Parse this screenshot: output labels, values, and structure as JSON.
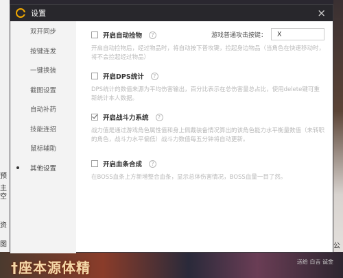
{
  "dialog": {
    "title": "设置",
    "close_glyph": "×"
  },
  "sidebar": {
    "items": [
      {
        "label": "双开同步"
      },
      {
        "label": "按键连发"
      },
      {
        "label": "一键换装"
      },
      {
        "label": "截图设置"
      },
      {
        "label": "自动补药"
      },
      {
        "label": "技能连招"
      },
      {
        "label": "鼠标辅助"
      },
      {
        "label": "其他设置",
        "active": true
      }
    ]
  },
  "options": [
    {
      "label": "开启自动捡物",
      "checked": false,
      "key_label": "游戏普通攻击按键：",
      "key_value": "X",
      "desc": "开启自动捡物后，经过物品时，将自动按下普攻键，捡起身边物品（当角色在快速移动时，将不会捡起经过物品）"
    },
    {
      "label": "开启DPS统计",
      "checked": false,
      "desc": "DPS统计的数值来源为平均伤害输出，百分比表示在总伤害量总占比，使用delete键可重新统计本人数据。"
    },
    {
      "label": "开启战斗力系统",
      "checked": true,
      "desc": "战力值是通过游戏角色属性值和身上佩戴装备情况算出的该角色能力水平衡量数值（未转职的角色，战斗力水平偏低）战斗力数值每五分钟将自动更新。"
    },
    {
      "label": "开启血条合成",
      "checked": false,
      "desc": "在BOSS血条上方新增整合血条，显示总体伤害情况，BOSS血量一目了然。"
    }
  ],
  "background": {
    "left_snips": [
      "预",
      "主",
      "空",
      "资",
      "图"
    ],
    "right_snips": [
      "公"
    ],
    "bottom_banner": "†座本源体精",
    "bottom_right": "送给 白吉 诚金"
  },
  "colors": {
    "titlebar": "#28272c",
    "logo": "#f2a900",
    "sidebar": "#f3f3f3",
    "desc_text": "#b9b9b9"
  },
  "icons": {
    "logo": "app-logo-icon",
    "close": "close-icon",
    "help": "question-circle-icon",
    "checkbox_checked": "checkmark-icon"
  }
}
